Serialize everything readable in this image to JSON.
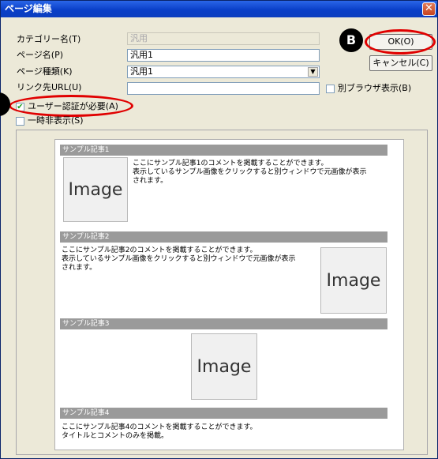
{
  "window": {
    "title": "ページ編集",
    "close_label": "✕"
  },
  "form": {
    "category_label": "カテゴリー名(T)",
    "category_value": "汎用",
    "page_name_label": "ページ名(P)",
    "page_name_value": "汎用1",
    "page_type_label": "ページ種類(K)",
    "page_type_value": "汎用1",
    "link_url_label": "リンク先URL(U)",
    "link_url_value": "",
    "other_browser_label": "別ブラウザ表示(B)",
    "auth_required_label": "ユーザー認証が必要(A)",
    "auth_required_checked": true,
    "temp_hide_label": "一時非表示(S)",
    "temp_hide_checked": false
  },
  "buttons": {
    "ok_label": "OK(O)",
    "cancel_label": "キャンセル(C)"
  },
  "markers": {
    "b_label": "B"
  },
  "preview": {
    "articles": [
      {
        "title": "サンプル記事1",
        "text": [
          "ここにサンプル記事1のコメントを掲載することができます。",
          "表示しているサンプル画像をクリックすると別ウィンドウで元画像が表示",
          "されます。"
        ],
        "image_label": "Image"
      },
      {
        "title": "サンプル記事2",
        "text": [
          "ここにサンプル記事2のコメントを掲載することができます。",
          "表示しているサンプル画像をクリックすると別ウィンドウで元画像が表示",
          "されます。"
        ],
        "image_label": "Image"
      },
      {
        "title": "サンプル記事3",
        "text": [],
        "image_label": "Image"
      },
      {
        "title": "サンプル記事4",
        "text": [
          "ここにサンプル記事4のコメントを掲載することができます。",
          "タイトルとコメントのみを掲載。"
        ],
        "image_label": ""
      }
    ]
  }
}
